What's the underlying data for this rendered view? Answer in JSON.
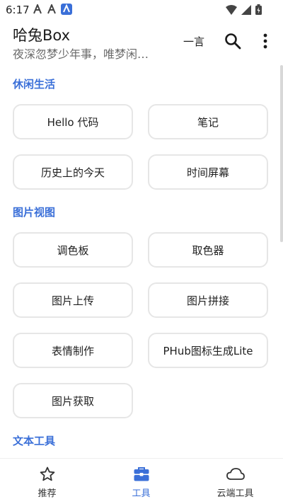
{
  "status": {
    "time": "6:17"
  },
  "app": {
    "title": "哈兔Box",
    "subtitle": "夜深忽梦少年事，唯梦闲…",
    "action_text": "一言"
  },
  "sections": [
    {
      "title": "休闲生活",
      "tools": [
        "Hello 代码",
        "笔记",
        "历史上的今天",
        "时间屏幕"
      ]
    },
    {
      "title": "图片视图",
      "tools": [
        "调色板",
        "取色器",
        "图片上传",
        "图片拼接",
        "表情制作",
        "PHub图标生成Lite",
        "图片获取"
      ]
    },
    {
      "title": "文本工具",
      "tools": []
    }
  ],
  "bottom_nav": [
    {
      "label": "推荐",
      "icon": "star-icon",
      "active": false
    },
    {
      "label": "工具",
      "icon": "toolbox-icon",
      "active": true
    },
    {
      "label": "云端工具",
      "icon": "cloud-icon",
      "active": false
    }
  ],
  "colors": {
    "accent": "#3a6fd8",
    "border": "#e6e6e6",
    "text": "#1f1f1f"
  }
}
